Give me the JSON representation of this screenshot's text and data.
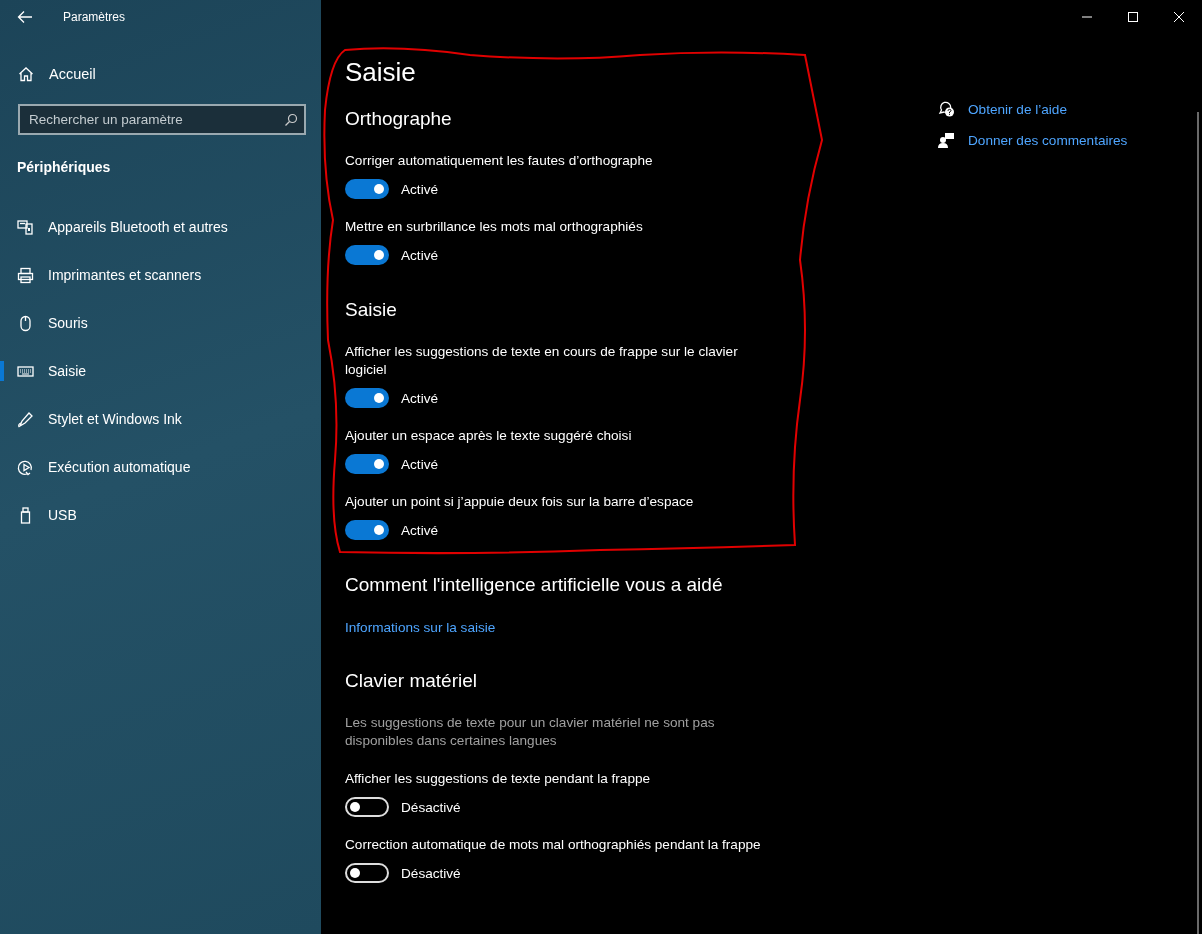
{
  "window": {
    "title": "Paramètres"
  },
  "sidebar": {
    "home": "Accueil",
    "search": {
      "placeholder": "Rechercher un paramètre"
    },
    "category": "Périphériques",
    "items": [
      {
        "label": "Appareils Bluetooth et autres",
        "selected": false
      },
      {
        "label": "Imprimantes et scanners",
        "selected": false
      },
      {
        "label": "Souris",
        "selected": false
      },
      {
        "label": "Saisie",
        "selected": true
      },
      {
        "label": "Stylet et Windows Ink",
        "selected": false
      },
      {
        "label": "Exécution automatique",
        "selected": false
      },
      {
        "label": "USB",
        "selected": false
      }
    ]
  },
  "page": {
    "title": "Saisie",
    "sections": [
      {
        "heading": "Orthographe",
        "items": [
          {
            "kind": "toggle",
            "label": "Corriger automatiquement les fautes d’orthographe",
            "on": true,
            "state": "Activé"
          },
          {
            "kind": "toggle",
            "label": "Mettre en surbrillance les mots mal orthographiés",
            "on": true,
            "state": "Activé"
          }
        ]
      },
      {
        "heading": "Saisie",
        "items": [
          {
            "kind": "toggle",
            "label": "Afficher les suggestions de texte en cours de frappe sur le clavier logiciel",
            "on": true,
            "state": "Activé"
          },
          {
            "kind": "toggle",
            "label": "Ajouter un espace après le texte suggéré choisi",
            "on": true,
            "state": "Activé"
          },
          {
            "kind": "toggle",
            "label": "Ajouter un point si j’appuie deux fois sur la barre d’espace",
            "on": true,
            "state": "Activé"
          }
        ]
      },
      {
        "heading": "Comment l'intelligence artificielle vous a aidé",
        "items": [
          {
            "kind": "link",
            "label": "Informations sur la saisie"
          }
        ]
      },
      {
        "heading": "Clavier matériel",
        "items": [
          {
            "kind": "description",
            "label": "Les suggestions de texte pour un clavier matériel ne sont pas disponibles dans certaines langues"
          },
          {
            "kind": "toggle",
            "label": "Afficher les suggestions de texte pendant la frappe",
            "on": false,
            "state": "Désactivé"
          },
          {
            "kind": "toggle",
            "label": "Correction automatique de mots mal orthographiés pendant la frappe",
            "on": false,
            "state": "Désactivé"
          }
        ]
      }
    ]
  },
  "help_links": [
    {
      "label": "Obtenir de l’aide"
    },
    {
      "label": "Donner des commentaires"
    }
  ],
  "annotation": {
    "kind": "freehand-outline"
  }
}
